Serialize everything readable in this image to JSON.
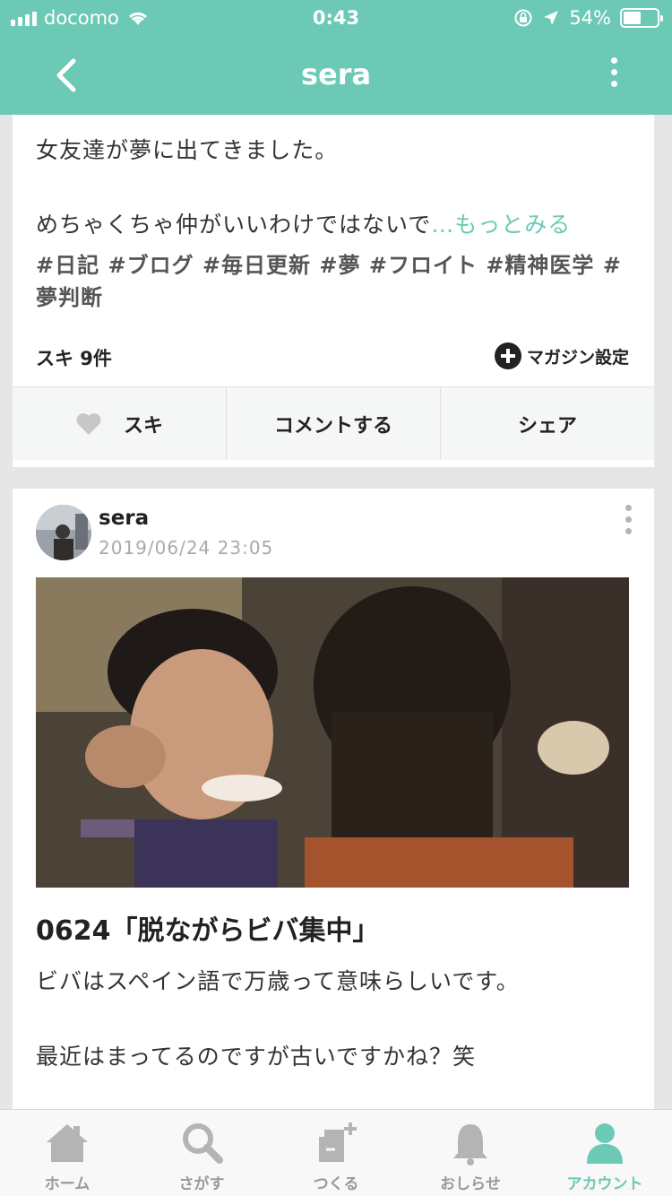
{
  "status": {
    "carrier": "docomo",
    "time": "0:43",
    "battery": "54%",
    "battery_level": 0.54
  },
  "nav": {
    "title": "sera"
  },
  "post1": {
    "line1": "女友達が夢に出てきました。",
    "line2": "めちゃくちゃ仲がいいわけではないで",
    "more": "…もっとみる",
    "tags": "#日記 #ブログ #毎日更新 #夢 #フロイト #精神医学 #夢判断",
    "likes": "スキ 9件",
    "magazine": "マガジン設定",
    "actions": {
      "like": "スキ",
      "comment": "コメントする",
      "share": "シェア"
    }
  },
  "post2": {
    "author": "sera",
    "date": "2019/06/24 23:05",
    "title": "0624「脱ながらビバ集中」",
    "line1": "ビバはスペイン語で万歳って意味らしいです。",
    "line2": "最近はまってるのですが古いですかね？笑"
  },
  "tabs": [
    {
      "label": "ホーム",
      "icon": "home-icon"
    },
    {
      "label": "さがす",
      "icon": "search-icon"
    },
    {
      "label": "つくる",
      "icon": "create-icon"
    },
    {
      "label": "おしらせ",
      "icon": "bell-icon"
    },
    {
      "label": "アカウント",
      "icon": "account-icon"
    }
  ],
  "colors": {
    "brand": "#6cc9b5",
    "tab_inactive": "#999999"
  }
}
